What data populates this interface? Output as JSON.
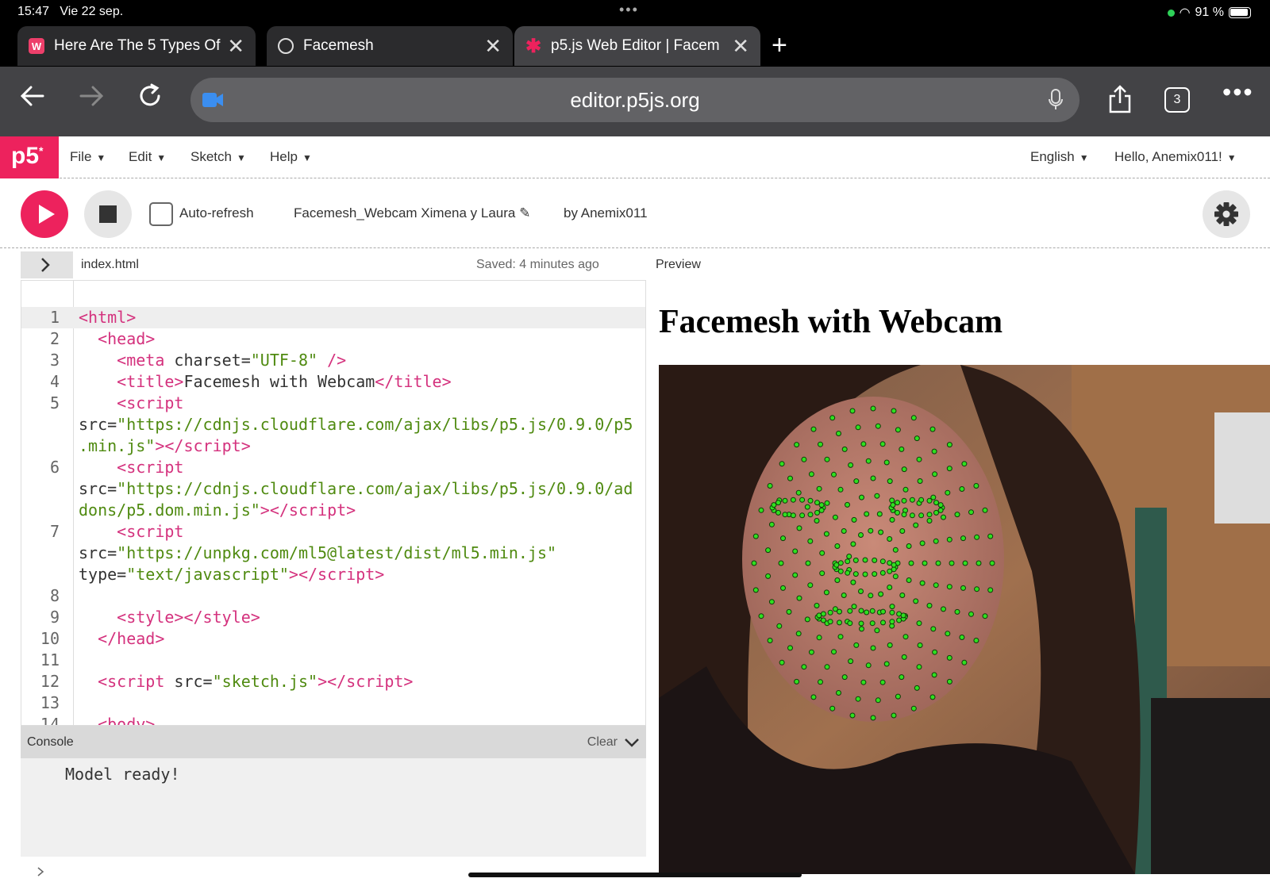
{
  "status": {
    "time": "15:47",
    "date": "Vie 22 sep.",
    "battery": "91 %"
  },
  "tabs": [
    {
      "label": "Here Are The 5 Types Of",
      "active": false
    },
    {
      "label": "Facemesh",
      "active": false
    },
    {
      "label": "p5.js Web Editor | Facem",
      "active": true
    }
  ],
  "address": {
    "url": "editor.p5js.org",
    "tab_count": "3"
  },
  "menubar": {
    "logo": "p5",
    "items": [
      "File",
      "Edit",
      "Sketch",
      "Help"
    ],
    "language": "English",
    "user": "Hello, Anemix011!"
  },
  "toolbar": {
    "auto_refresh": "Auto-refresh",
    "sketch_name": "Facemesh_Webcam Ximena y Laura",
    "author": "by Anemix011"
  },
  "editor": {
    "file": "index.html",
    "saved": "Saved: 4 minutes ago"
  },
  "console": {
    "title": "Console",
    "clear": "Clear",
    "message": "Model ready!"
  },
  "preview": {
    "label": "Preview",
    "title": "Facemesh with Webcam"
  },
  "colors": {
    "accent": "#ed225d",
    "tag": "#d4317d",
    "string": "#4f8a10",
    "mesh_dot": "#2fe020"
  }
}
